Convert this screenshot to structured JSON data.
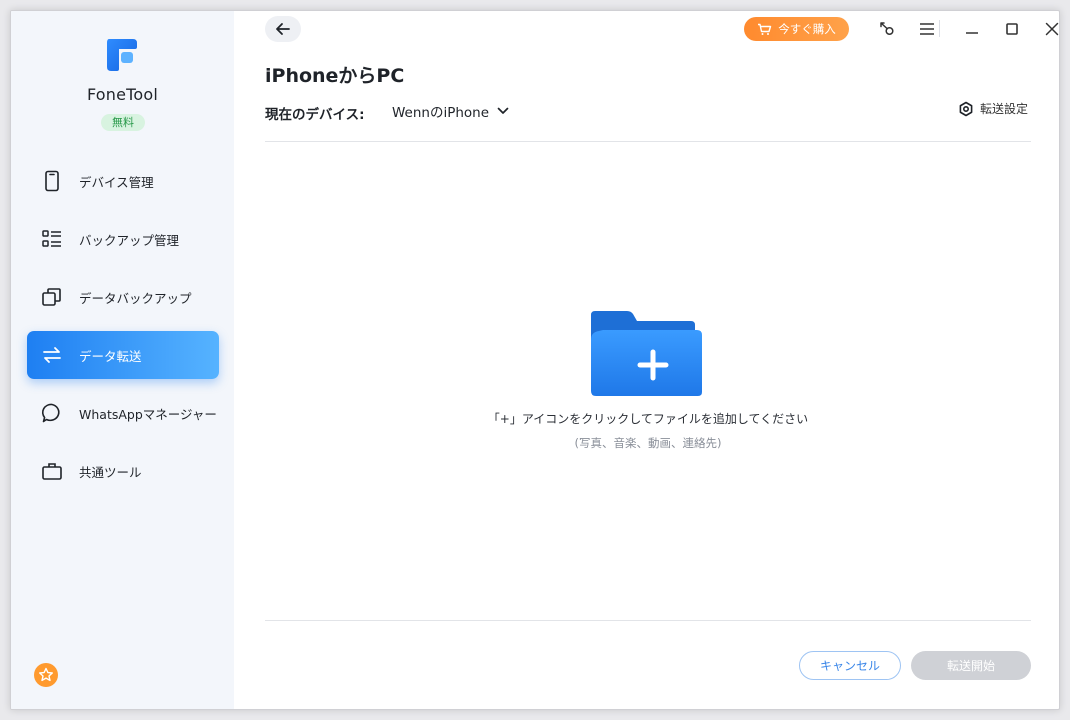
{
  "app": {
    "name": "FoneTool",
    "badge": "無料"
  },
  "sidebar": {
    "items": [
      {
        "label": "デバイス管理",
        "icon": "phone-icon",
        "active": false
      },
      {
        "label": "バックアップ管理",
        "icon": "list-icon",
        "active": false
      },
      {
        "label": "データバックアップ",
        "icon": "copy-icon",
        "active": false
      },
      {
        "label": "データ転送",
        "icon": "transfer-icon",
        "active": true
      },
      {
        "label": "WhatsAppマネージャー",
        "icon": "chat-icon",
        "active": false
      },
      {
        "label": "共通ツール",
        "icon": "toolbox-icon",
        "active": false
      }
    ],
    "footer_icon": "star-icon"
  },
  "toolbar": {
    "buy_label": "今すぐ購入",
    "icons": [
      "back-arrow-icon",
      "cart-icon",
      "key-icon",
      "menu-icon",
      "minimize-icon",
      "maximize-icon",
      "close-icon"
    ]
  },
  "main": {
    "title": "iPhoneからPC",
    "device_label": "現在のデバイス:",
    "device_value": "WennのiPhone",
    "settings_label": "転送設定",
    "hint": "「+」アイコンをクリックしてファイルを追加してください",
    "sub_hint": "(写真、音楽、動画、連絡先)",
    "cancel_label": "キャンセル",
    "start_label": "転送開始"
  },
  "colors": {
    "accent": "#1e7ff2",
    "buy": "#ff8a2e",
    "badge_bg": "#d8f3e0",
    "badge_text": "#2a9a4b",
    "folder": "#2d8cf0"
  }
}
